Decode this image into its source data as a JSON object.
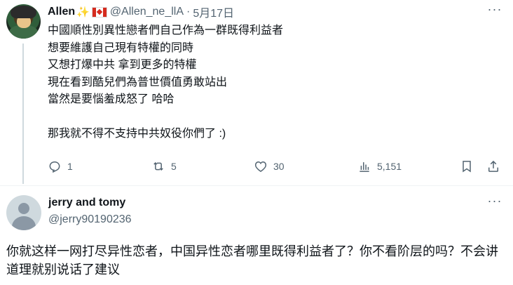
{
  "tweet": {
    "author_name": "Allen",
    "author_emoji_1": "✨",
    "handle": "@Allen_ne_llA",
    "separator": "·",
    "date": "5月17日",
    "more": "···",
    "text_lines": [
      "中國順性別異性戀者們自己作為一群既得利益者",
      "想要維護自己現有特權的同時",
      "又想打爆中共 拿到更多的特權",
      "現在看到酷兒們為普世價值勇敢站出",
      "當然是要惱羞成怒了 哈哈",
      "",
      "那我就不得不支持中共奴役你們了 :)"
    ],
    "replies": "1",
    "retweets": "5",
    "likes": "30",
    "views": "5,151"
  },
  "reply": {
    "author_name": "jerry and tomy",
    "handle": "@jerry90190236",
    "more": "···",
    "text": "你就这样一网打尽异性恋者，中国异性恋者哪里既得利益者了？你不看阶层的吗？不会讲道理就别说话了建议"
  },
  "icons": {
    "reply": "reply-icon",
    "retweet": "retweet-icon",
    "like": "heart-icon",
    "views": "views-icon",
    "bookmark": "bookmark-icon",
    "share": "share-icon"
  },
  "colors": {
    "text": "#0f1419",
    "secondary": "#536471",
    "divider": "#eff3f4"
  }
}
